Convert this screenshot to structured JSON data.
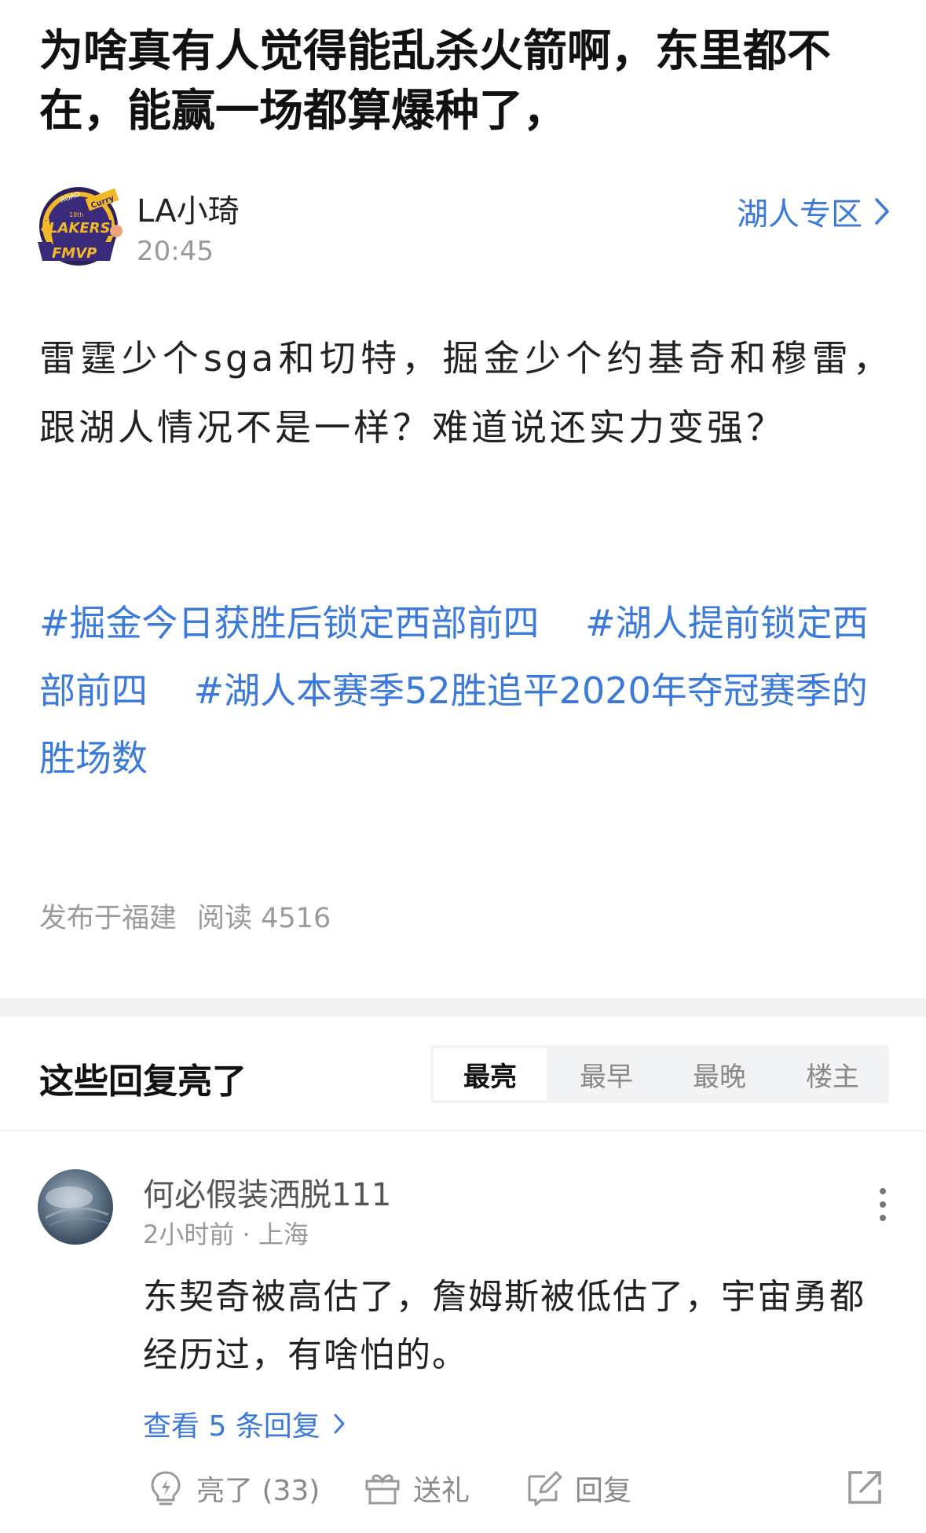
{
  "post": {
    "title": "为啥真有人觉得能乱杀火箭啊，东里都不在，能赢一场都算爆种了，",
    "author": "LA小琦",
    "time": "20:45",
    "zone": "湖人专区",
    "avatar_badge_text": [
      "ROAD",
      "Curry",
      "18th",
      "LAKERS",
      "FMVP"
    ],
    "body": "雷霆少个sga和切特，掘金少个约基奇和穆雷，跟湖人情况不是一样？难道说还实力变强？",
    "topics": [
      "#掘金今日获胜后锁定西部前四",
      "#湖人提前锁定西部前四",
      "#湖人本赛季52胜追平2020年夺冠赛季的胜场数"
    ],
    "location": "发布于福建",
    "reads": "阅读 4516"
  },
  "replies": {
    "heading": "这些回复亮了",
    "tabs": [
      "最亮",
      "最早",
      "最晚",
      "楼主"
    ],
    "active_tab": "最亮"
  },
  "comment": {
    "user": "何必假装洒脱111",
    "meta": "2小时前 · 上海",
    "text": "东契奇被高估了，詹姆斯被低估了，宇宙勇都经历过，有啥怕的。",
    "view_replies": "查看 5 条回复",
    "actions": {
      "like": "亮了 (33)",
      "gift": "送礼",
      "reply": "回复"
    }
  },
  "colors": {
    "link": "#3b7ad8",
    "muted": "#999999",
    "band": "#f2f3f5"
  }
}
